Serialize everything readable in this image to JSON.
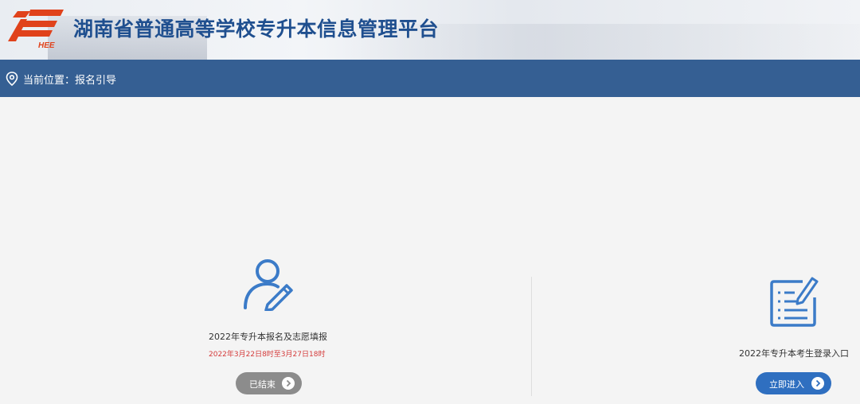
{
  "header": {
    "logo_text": "HEE",
    "site_title": "湖南省普通高等学校专升本信息管理平台"
  },
  "breadcrumb": {
    "icon": "location-pin-icon",
    "text": "当前位置：报名引导"
  },
  "cards": [
    {
      "icon": "user-edit-icon",
      "title": "2022年专升本报名及志愿填报",
      "date": "2022年3月22日8时至3月27日18时",
      "button_label": "已结束",
      "button_color": "#8c8c8c"
    },
    {
      "icon": "form-edit-icon",
      "title": "2022年专升本考生登录入口",
      "button_label": "立即进入",
      "button_color": "#2f6fc0"
    }
  ],
  "colors": {
    "brand_blue": "#355f93",
    "title_blue": "#1f4f8f",
    "logo_red": "#e0421b",
    "date_red": "#d43a3a",
    "icon_blue": "#3b7bc8"
  }
}
